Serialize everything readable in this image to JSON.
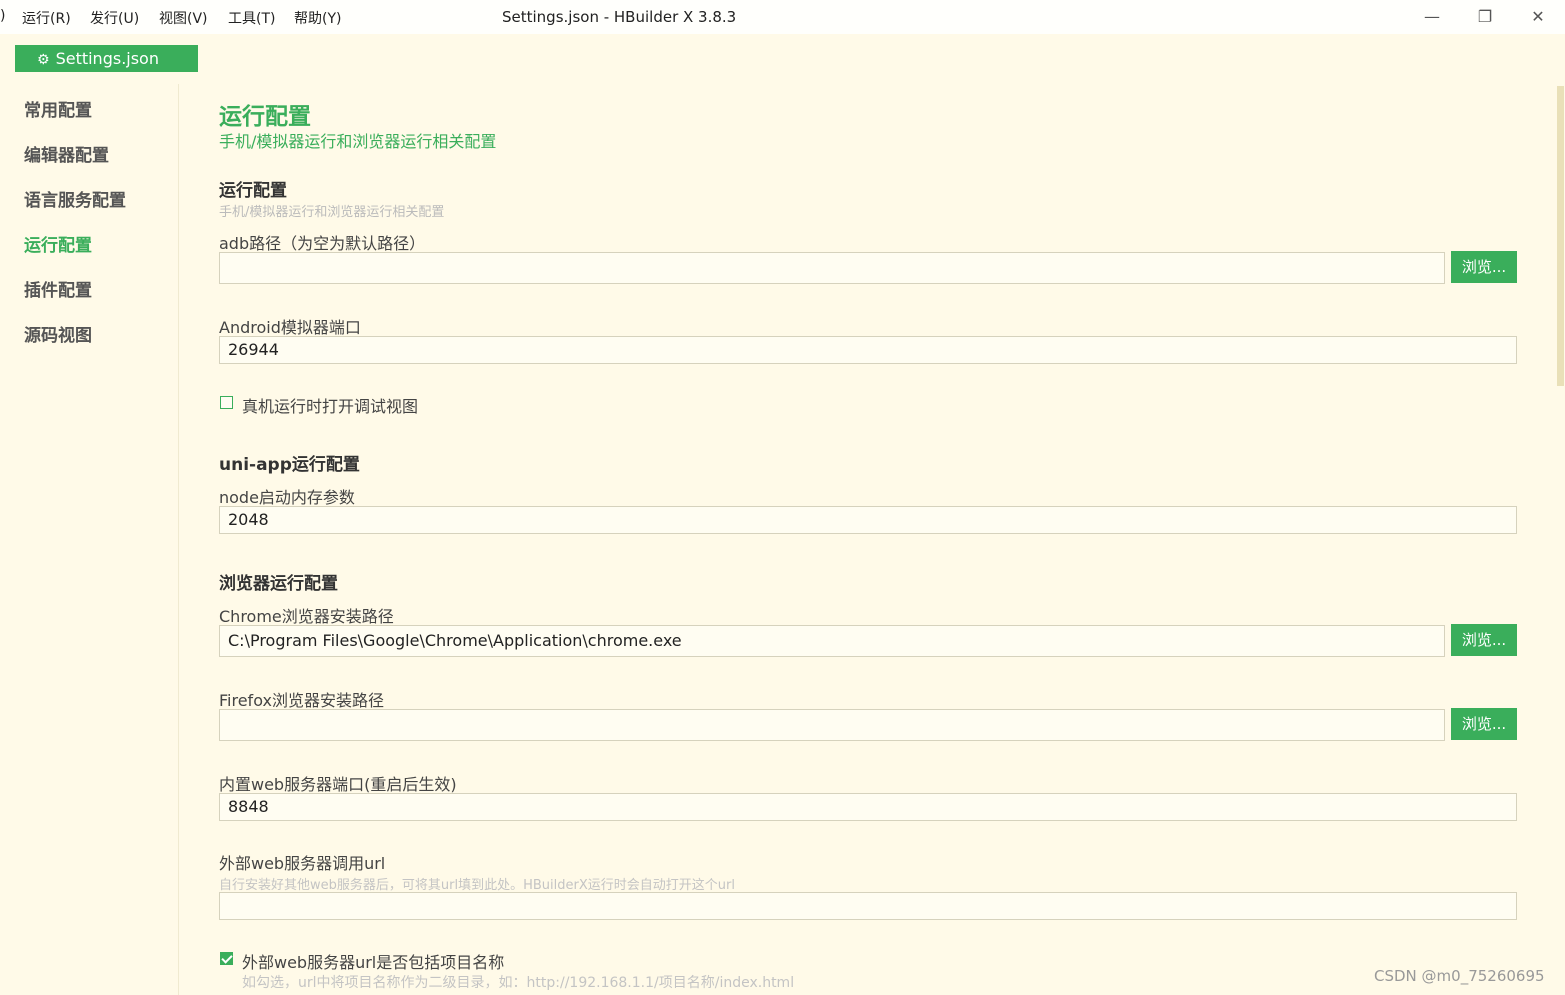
{
  "menubar": {
    "partial": ")",
    "items": [
      "运行(R)",
      "发行(U)",
      "视图(V)",
      "工具(T)",
      "帮助(Y)"
    ]
  },
  "window": {
    "title": "Settings.json - HBuilder X 3.8.3",
    "minimize": "—",
    "maximize": "❐",
    "close": "✕"
  },
  "file_tab": {
    "icon": "gear-icon",
    "label": "Settings.json"
  },
  "sidebar": {
    "items": [
      {
        "label": "常用配置",
        "active": false
      },
      {
        "label": "编辑器配置",
        "active": false
      },
      {
        "label": "语言服务配置",
        "active": false
      },
      {
        "label": "运行配置",
        "active": true
      },
      {
        "label": "插件配置",
        "active": false
      },
      {
        "label": "源码视图",
        "active": false
      }
    ]
  },
  "main": {
    "title": "运行配置",
    "subtitle": "手机/模拟器运行和浏览器运行相关配置",
    "run_section": {
      "title": "运行配置",
      "desc": "手机/模拟器运行和浏览器运行相关配置",
      "adb_label": "adb路径（为空为默认路径）",
      "adb_value": "",
      "android_port_label": "Android模拟器端口",
      "android_port_value": "26944",
      "debug_view_label": "真机运行时打开调试视图",
      "debug_view_checked": false
    },
    "uniapp_section": {
      "title": "uni-app运行配置",
      "node_mem_label": "node启动内存参数",
      "node_mem_value": "2048"
    },
    "browser_section": {
      "title": "浏览器运行配置",
      "chrome_label": "Chrome浏览器安装路径",
      "chrome_value": "C:\\Program Files\\Google\\Chrome\\Application\\chrome.exe",
      "firefox_label": "Firefox浏览器安装路径",
      "firefox_value": "",
      "web_port_label": "内置web服务器端口(重启后生效)",
      "web_port_value": "8848",
      "ext_url_label": "外部web服务器调用url",
      "ext_url_hint": "自行安装好其他web服务器后，可将其url填到此处。HBuilderX运行时会自动打开这个url",
      "ext_url_value": "",
      "include_name_label": "外部web服务器url是否包括项目名称",
      "include_name_hint": "如勾选，url中将项目名称作为二级目录，如：http://192.168.1.1/项目名称/index.html",
      "include_name_checked": true
    },
    "browse_label": "浏览..."
  },
  "watermark": "CSDN @m0_75260695",
  "colors": {
    "accent": "#3aae5b",
    "background": "#fffae8"
  }
}
